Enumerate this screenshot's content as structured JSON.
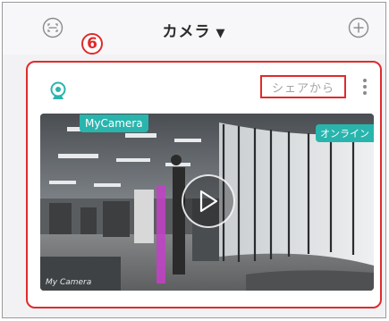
{
  "header": {
    "title": "カメラ",
    "title_caret": "▼",
    "left_icon": "scan-icon",
    "right_icon": "add-circle-icon"
  },
  "callout": {
    "number": "6"
  },
  "card": {
    "camera_icon": "camera-icon",
    "share_label": "シェアから",
    "more_icon": "more-vertical-icon",
    "camera_name": "MyCamera",
    "status": "オンライン",
    "watermark": "My Camera"
  },
  "colors": {
    "accent": "#29b5ad",
    "highlight": "#e02b2b"
  }
}
